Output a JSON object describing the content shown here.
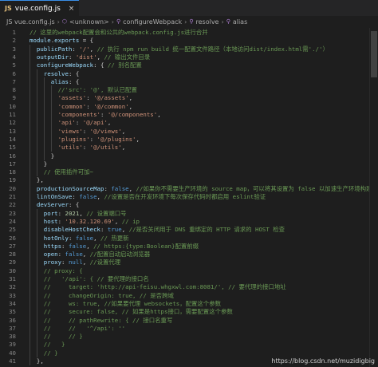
{
  "tab": {
    "icon": "JS",
    "title": "vue.config.js",
    "close": "×"
  },
  "breadcrumb": [
    {
      "label": "JS vue.config.js",
      "icon": ""
    },
    {
      "label": "<unknown>",
      "icon": "⬡"
    },
    {
      "label": "configureWebpack",
      "icon": "⚲"
    },
    {
      "label": "resolve",
      "icon": "⚲"
    },
    {
      "label": "alias",
      "icon": "⚲"
    }
  ],
  "colors": {
    "comment": "#6a9955",
    "keyword": "#569cd6",
    "string": "#ce9178",
    "number": "#b5cea8",
    "prop": "#9cdcfe",
    "plain": "#d4d4d4",
    "punct": "#ffd700"
  },
  "lines": [
    {
      "n": "1",
      "ind": 0,
      "t": [
        [
          "c",
          "// 这里的webpack配置会和公共的webpack.config.js进行合并"
        ]
      ]
    },
    {
      "n": "2",
      "ind": 0,
      "t": [
        [
          "p",
          "module"
        ],
        [
          "x",
          "."
        ],
        [
          "p",
          "exports"
        ],
        [
          "x",
          " = {"
        ]
      ]
    },
    {
      "n": "3",
      "ind": 1,
      "t": [
        [
          "p",
          "publicPath"
        ],
        [
          "x",
          ": "
        ],
        [
          "s",
          "'/'"
        ],
        [
          "x",
          ", "
        ],
        [
          "c",
          "// 执行 npm run build 统一配置文件路径（本地访问dist/index.html需'./'）"
        ]
      ]
    },
    {
      "n": "4",
      "ind": 1,
      "t": [
        [
          "p",
          "outputDir"
        ],
        [
          "x",
          ": "
        ],
        [
          "s",
          "'dist'"
        ],
        [
          "x",
          ", "
        ],
        [
          "c",
          "// 输出文件目录"
        ]
      ]
    },
    {
      "n": "5",
      "ind": 1,
      "t": [
        [
          "p",
          "configureWebpack"
        ],
        [
          "x",
          ": { "
        ],
        [
          "c",
          "// 别名配置"
        ]
      ]
    },
    {
      "n": "6",
      "ind": 2,
      "t": [
        [
          "p",
          "resolve"
        ],
        [
          "x",
          ": {"
        ]
      ]
    },
    {
      "n": "7",
      "ind": 3,
      "t": [
        [
          "p",
          "alias"
        ],
        [
          "x",
          ": {"
        ]
      ]
    },
    {
      "n": "8",
      "ind": 4,
      "t": [
        [
          "c",
          "//'src': '@', 默认已配置"
        ]
      ]
    },
    {
      "n": "9",
      "ind": 4,
      "t": [
        [
          "s",
          "'assets'"
        ],
        [
          "x",
          ": "
        ],
        [
          "s",
          "'@/assets'"
        ],
        [
          "x",
          ","
        ]
      ]
    },
    {
      "n": "10",
      "ind": 4,
      "t": [
        [
          "s",
          "'common'"
        ],
        [
          "x",
          ": "
        ],
        [
          "s",
          "'@/common'"
        ],
        [
          "x",
          ","
        ]
      ]
    },
    {
      "n": "11",
      "ind": 4,
      "t": [
        [
          "s",
          "'components'"
        ],
        [
          "x",
          ": "
        ],
        [
          "s",
          "'@/components'"
        ],
        [
          "x",
          ","
        ]
      ]
    },
    {
      "n": "12",
      "ind": 4,
      "t": [
        [
          "s",
          "'api'"
        ],
        [
          "x",
          ": "
        ],
        [
          "s",
          "'@/api'"
        ],
        [
          "x",
          ","
        ]
      ]
    },
    {
      "n": "13",
      "ind": 4,
      "t": [
        [
          "s",
          "'views'"
        ],
        [
          "x",
          ": "
        ],
        [
          "s",
          "'@/views'"
        ],
        [
          "x",
          ","
        ]
      ]
    },
    {
      "n": "14",
      "ind": 4,
      "t": [
        [
          "s",
          "'plugins'"
        ],
        [
          "x",
          ": "
        ],
        [
          "s",
          "'@/plugins'"
        ],
        [
          "x",
          ","
        ]
      ]
    },
    {
      "n": "15",
      "ind": 4,
      "t": [
        [
          "s",
          "'utils'"
        ],
        [
          "x",
          ": "
        ],
        [
          "s",
          "'@/utils'"
        ],
        [
          "x",
          ","
        ]
      ]
    },
    {
      "n": "16",
      "ind": 3,
      "t": [
        [
          "x",
          "}"
        ]
      ]
    },
    {
      "n": "17",
      "ind": 2,
      "t": [
        [
          "x",
          "}"
        ]
      ]
    },
    {
      "n": "18",
      "ind": 2,
      "t": [
        [
          "c",
          "// 使用插件可加~"
        ]
      ]
    },
    {
      "n": "19",
      "ind": 1,
      "t": [
        [
          "x",
          "},"
        ]
      ]
    },
    {
      "n": "20",
      "ind": 1,
      "t": [
        [
          "p",
          "productionSourceMap"
        ],
        [
          "x",
          ": "
        ],
        [
          "k",
          "false"
        ],
        [
          "x",
          ", "
        ],
        [
          "c",
          "//如果你不需要生产环境的 source map，可以将其设置为 false 以加速生产环境构建"
        ]
      ]
    },
    {
      "n": "21",
      "ind": 1,
      "t": [
        [
          "p",
          "lintOnSave"
        ],
        [
          "x",
          ": "
        ],
        [
          "k",
          "false"
        ],
        [
          "x",
          ", "
        ],
        [
          "c",
          "//设置是否在开发环境下每次保存代码时都启用 eslint验证"
        ]
      ]
    },
    {
      "n": "22",
      "ind": 1,
      "t": [
        [
          "p",
          "devServer"
        ],
        [
          "x",
          ": {"
        ]
      ]
    },
    {
      "n": "23",
      "ind": 2,
      "t": [
        [
          "p",
          "port"
        ],
        [
          "x",
          ": "
        ],
        [
          "n",
          "2021"
        ],
        [
          "x",
          ", "
        ],
        [
          "c",
          "// 设置端口号"
        ]
      ]
    },
    {
      "n": "24",
      "ind": 2,
      "t": [
        [
          "p",
          "host"
        ],
        [
          "x",
          ": "
        ],
        [
          "s",
          "'10.32.120.69'"
        ],
        [
          "x",
          ", "
        ],
        [
          "c",
          "// ip"
        ]
      ]
    },
    {
      "n": "25",
      "ind": 2,
      "t": [
        [
          "p",
          "disableHostCheck"
        ],
        [
          "x",
          ": "
        ],
        [
          "k",
          "true"
        ],
        [
          "x",
          ", "
        ],
        [
          "c",
          "//是否关闭用于 DNS 重绑定的 HTTP 请求的 HOST 检查"
        ]
      ]
    },
    {
      "n": "26",
      "ind": 2,
      "t": [
        [
          "p",
          "hotOnly"
        ],
        [
          "x",
          ": "
        ],
        [
          "k",
          "false"
        ],
        [
          "x",
          ", "
        ],
        [
          "c",
          "// 热更新"
        ]
      ]
    },
    {
      "n": "27",
      "ind": 2,
      "t": [
        [
          "p",
          "https"
        ],
        [
          "x",
          ": "
        ],
        [
          "k",
          "false"
        ],
        [
          "x",
          ", "
        ],
        [
          "c",
          "// https:{type:Boolean}配置前缀"
        ]
      ]
    },
    {
      "n": "28",
      "ind": 2,
      "t": [
        [
          "p",
          "open"
        ],
        [
          "x",
          ": "
        ],
        [
          "k",
          "false"
        ],
        [
          "x",
          ", "
        ],
        [
          "c",
          "//配置自动启动浏览器"
        ]
      ]
    },
    {
      "n": "29",
      "ind": 2,
      "t": [
        [
          "p",
          "proxy"
        ],
        [
          "x",
          ": "
        ],
        [
          "k",
          "null"
        ],
        [
          "x",
          ", "
        ],
        [
          "c",
          "//设置代理"
        ]
      ]
    },
    {
      "n": "30",
      "ind": 2,
      "t": [
        [
          "c",
          "// proxy: {"
        ]
      ]
    },
    {
      "n": "31",
      "ind": 2,
      "t": [
        [
          "c",
          "//   '/api': { // 要代理的接口名"
        ]
      ]
    },
    {
      "n": "32",
      "ind": 2,
      "t": [
        [
          "c",
          "//     target: 'http://api-feisu.whgxwl.com:8081/', // 要代理的接口地址"
        ]
      ]
    },
    {
      "n": "33",
      "ind": 2,
      "t": [
        [
          "c",
          "//     changeOrigin: true, // 是否跨域"
        ]
      ]
    },
    {
      "n": "34",
      "ind": 2,
      "t": [
        [
          "c",
          "//     ws: true, //如果要代理 websockets，配置这个参数"
        ]
      ]
    },
    {
      "n": "35",
      "ind": 2,
      "t": [
        [
          "c",
          "//     secure: false, // 如果是https接口，需要配置这个参数"
        ]
      ]
    },
    {
      "n": "36",
      "ind": 2,
      "t": [
        [
          "c",
          "//     // pathRewrite: { // 接口名重写"
        ]
      ]
    },
    {
      "n": "37",
      "ind": 2,
      "t": [
        [
          "c",
          "//     //   '^/api': ''"
        ]
      ]
    },
    {
      "n": "38",
      "ind": 2,
      "t": [
        [
          "c",
          "//     // }"
        ]
      ]
    },
    {
      "n": "39",
      "ind": 2,
      "t": [
        [
          "c",
          "//   }"
        ]
      ]
    },
    {
      "n": "40",
      "ind": 2,
      "t": [
        [
          "c",
          "// }"
        ]
      ]
    },
    {
      "n": "41",
      "ind": 1,
      "t": [
        [
          "x",
          "},"
        ]
      ]
    }
  ],
  "watermark": "https://blog.csdn.net/muzidigbig"
}
